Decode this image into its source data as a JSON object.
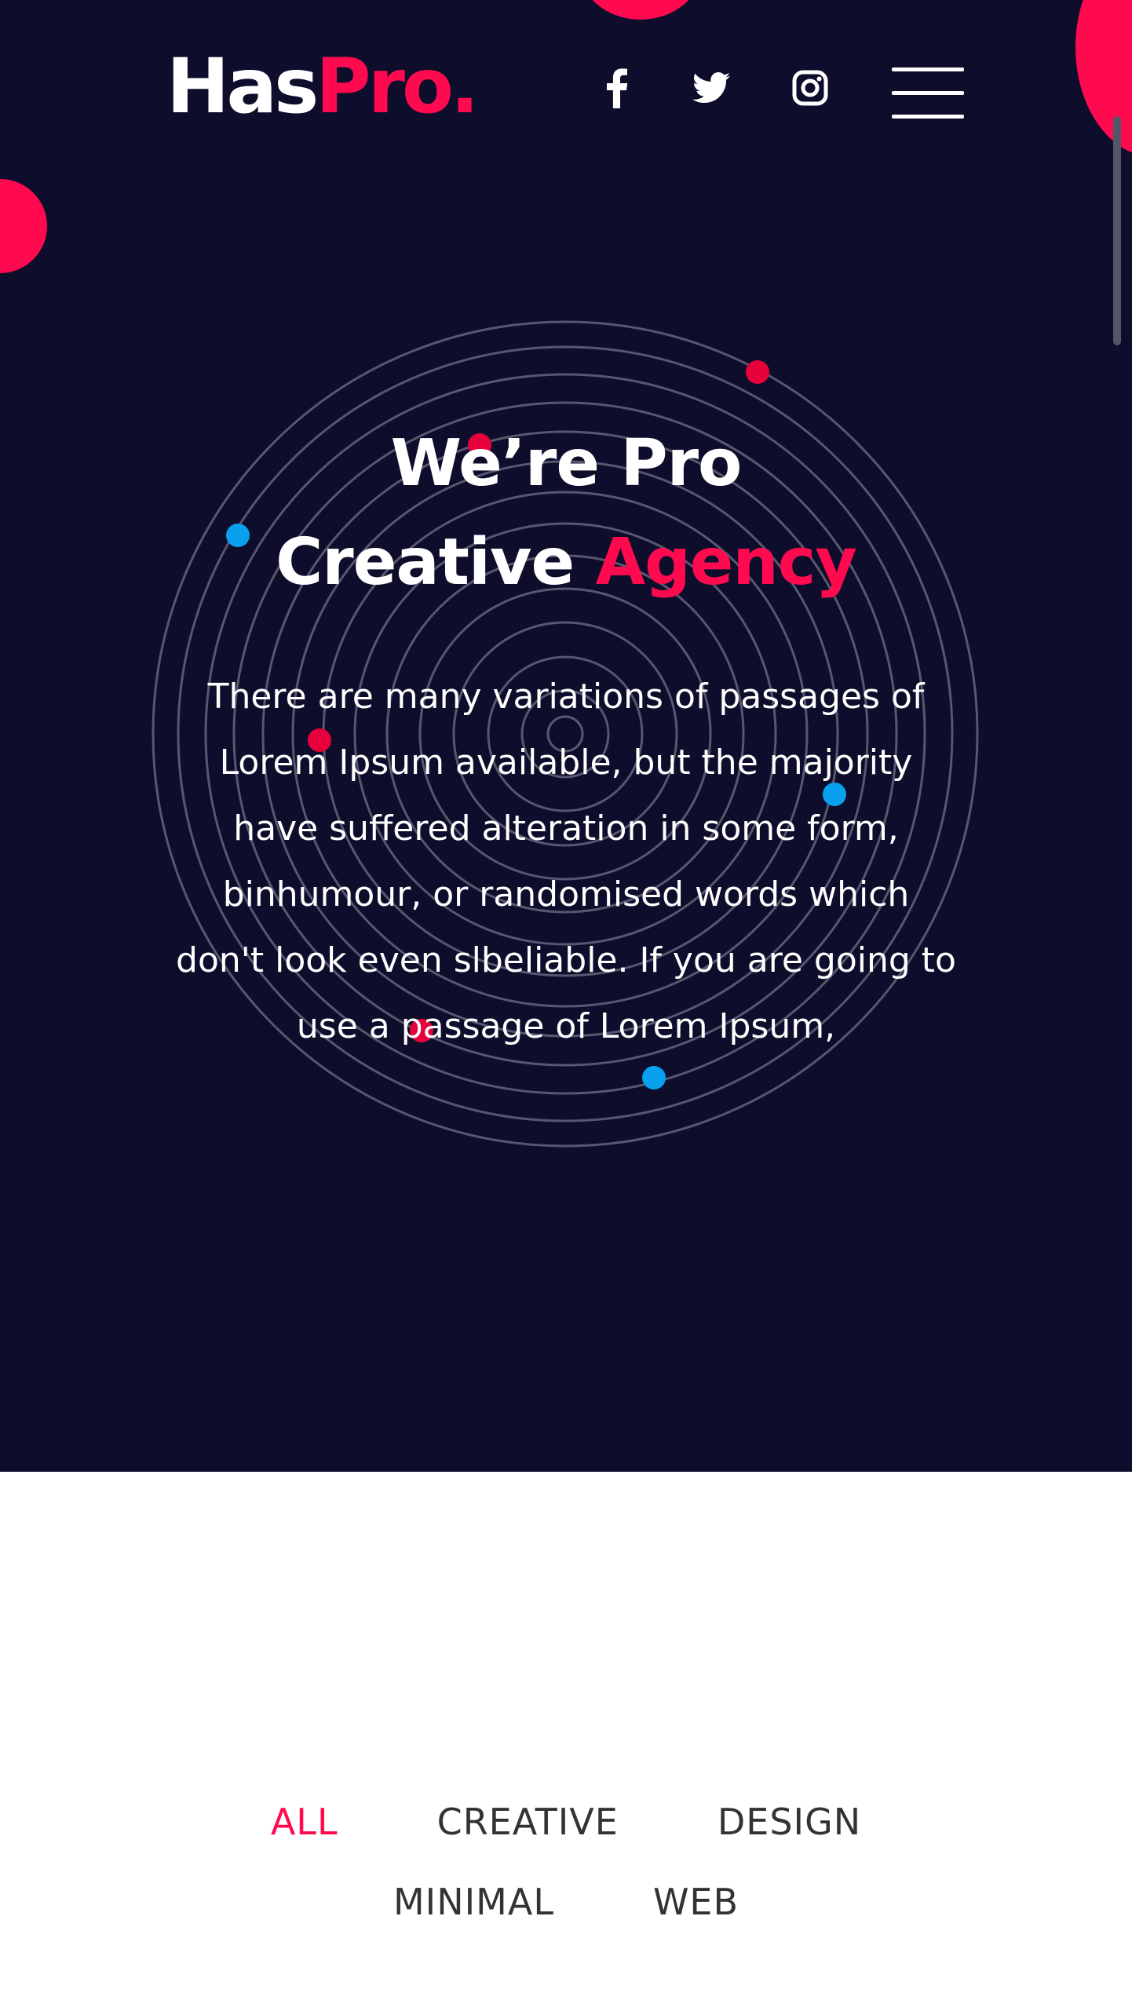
{
  "colors": {
    "background_dark": "#0e0e2c",
    "accent": "#ff0a4f",
    "dot_blue": "#0aa0f0",
    "text_light": "#ffffff",
    "text_dark": "#333333"
  },
  "header": {
    "logo": {
      "main": "Has",
      "accent": "Pro."
    },
    "social": [
      {
        "icon": "facebook-icon"
      },
      {
        "icon": "twitter-icon"
      },
      {
        "icon": "instagram-icon"
      }
    ],
    "menu_icon": "hamburger-menu-icon"
  },
  "hero": {
    "title_line1": "We’re Pro",
    "title_line2_main": "Creative",
    "title_line2_accent": "Agency",
    "description": "There are many variations of passages of Lorem Ipsum available, but the majority have suffered alteration in some form, binhumour, or randomised words which don't look even slbeliable. If you are going to use a passage of Lorem Ipsum,"
  },
  "filters": {
    "items": [
      {
        "label": "ALL",
        "active": true
      },
      {
        "label": "CREATIVE",
        "active": false
      },
      {
        "label": "DESIGN",
        "active": false
      },
      {
        "label": "MINIMAL",
        "active": false
      },
      {
        "label": "WEB",
        "active": false
      }
    ]
  }
}
